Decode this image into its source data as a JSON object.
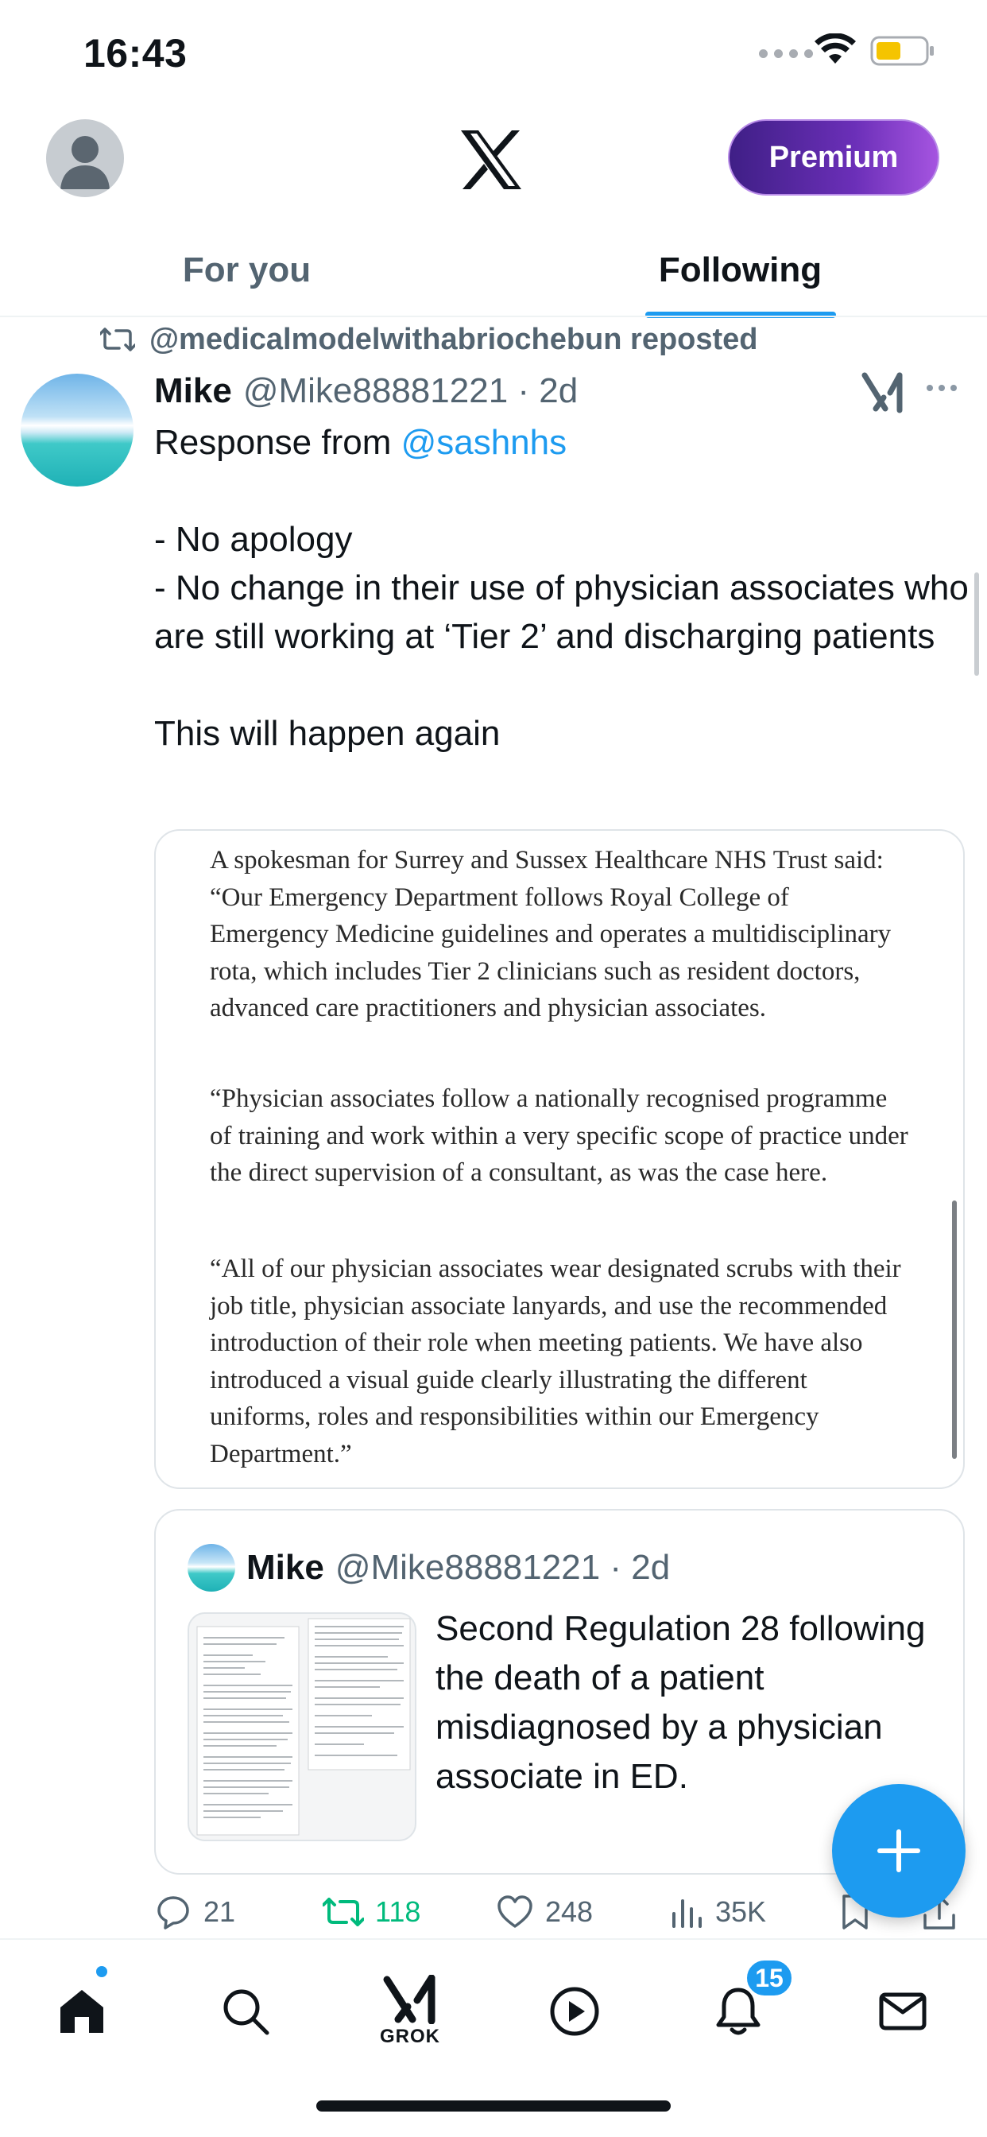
{
  "status_bar": {
    "time": "16:43"
  },
  "header": {
    "premium_label": "Premium",
    "tabs": [
      {
        "label": "For you",
        "active": false
      },
      {
        "label": "Following",
        "active": true
      }
    ]
  },
  "tweet": {
    "reposted_by": "@medicalmodelwithabriochebun reposted",
    "name": "Mike",
    "handle_time": "@Mike88881221 · 2d",
    "text_prefix": "Response from ",
    "mention": "@sashnhs",
    "text_body": "\n\n- No apology\n- No change in their use of physician associates who are still working at ‘Tier 2’ and discharging patients\n\nThis will happen again",
    "article_paragraphs": [
      "A spokesman for Surrey and Sussex Healthcare NHS Trust said: “Our Emergency Department follows Royal College of Emergency Medicine guidelines and operates a multidisciplinary rota, which includes Tier 2 clinicians such as resident doctors, advanced care practitioners and physician associates.",
      "“Physician associates follow a nationally recognised programme of training and work within a very specific scope of practice under the direct supervision of a consultant, as was the case here.",
      "“All of our physician associates wear designated scrubs with their job title, physician associate lanyards, and use the recommended introduction of their role when meeting patients. We have also introduced a visual guide clearly illustrating the different uniforms, roles and responsibilities within our Emergency Department.”"
    ],
    "quote": {
      "name": "Mike",
      "handle_time": "@Mike88881221 · 2d",
      "text": "Second Regulation 28 following the death of a patient misdiagnosed by a physician associate in ED."
    },
    "stats": {
      "replies": "21",
      "retweets": "118",
      "likes": "248",
      "views": "35K"
    }
  },
  "bottom_nav": {
    "grok_label": "GROK",
    "notifications_badge": "15"
  },
  "colors": {
    "accent": "#1d9bf0",
    "retweet_green": "#00ba7c",
    "secondary_text": "#536471"
  },
  "icons": [
    "wifi-icon",
    "battery-icon",
    "x-logo-icon",
    "retweet-icon",
    "grok-icon",
    "more-icon",
    "reply-icon",
    "like-icon",
    "views-icon",
    "bookmark-icon",
    "share-icon",
    "compose-icon",
    "home-icon",
    "search-icon",
    "play-icon",
    "bell-icon",
    "mail-icon"
  ]
}
